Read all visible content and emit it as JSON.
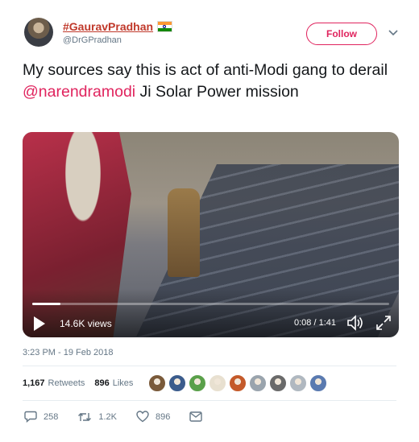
{
  "header": {
    "display_name": "#GauravPradhan",
    "handle": "@DrGPradhan",
    "follow_label": "Follow"
  },
  "tweet": {
    "text_before": "My sources say this is act of anti-Modi gang to derail ",
    "mention": "@narendramodi",
    "text_after": " Ji Solar Power mission"
  },
  "video": {
    "views": "14.6K views",
    "time": "0:08 / 1:41",
    "progress_fraction": 0.08
  },
  "timestamp": "3:23 PM - 19 Feb 2018",
  "stats": {
    "retweets_count": "1,167",
    "retweets_label": "Retweets",
    "likes_count": "896",
    "likes_label": "Likes"
  },
  "liker_avatar_colors": [
    "#7a5a3a",
    "#3b5c8c",
    "#5aa04a",
    "#e8e0d0",
    "#c45a2a",
    "#9aa4ad",
    "#6a6a6a",
    "#b0b8c0",
    "#5a7ab0"
  ],
  "actions": {
    "replies": "258",
    "retweets": "1.2K",
    "likes": "896"
  },
  "colors": {
    "accent": "#e0245e",
    "name": "#c0392b",
    "muted": "#657786"
  }
}
